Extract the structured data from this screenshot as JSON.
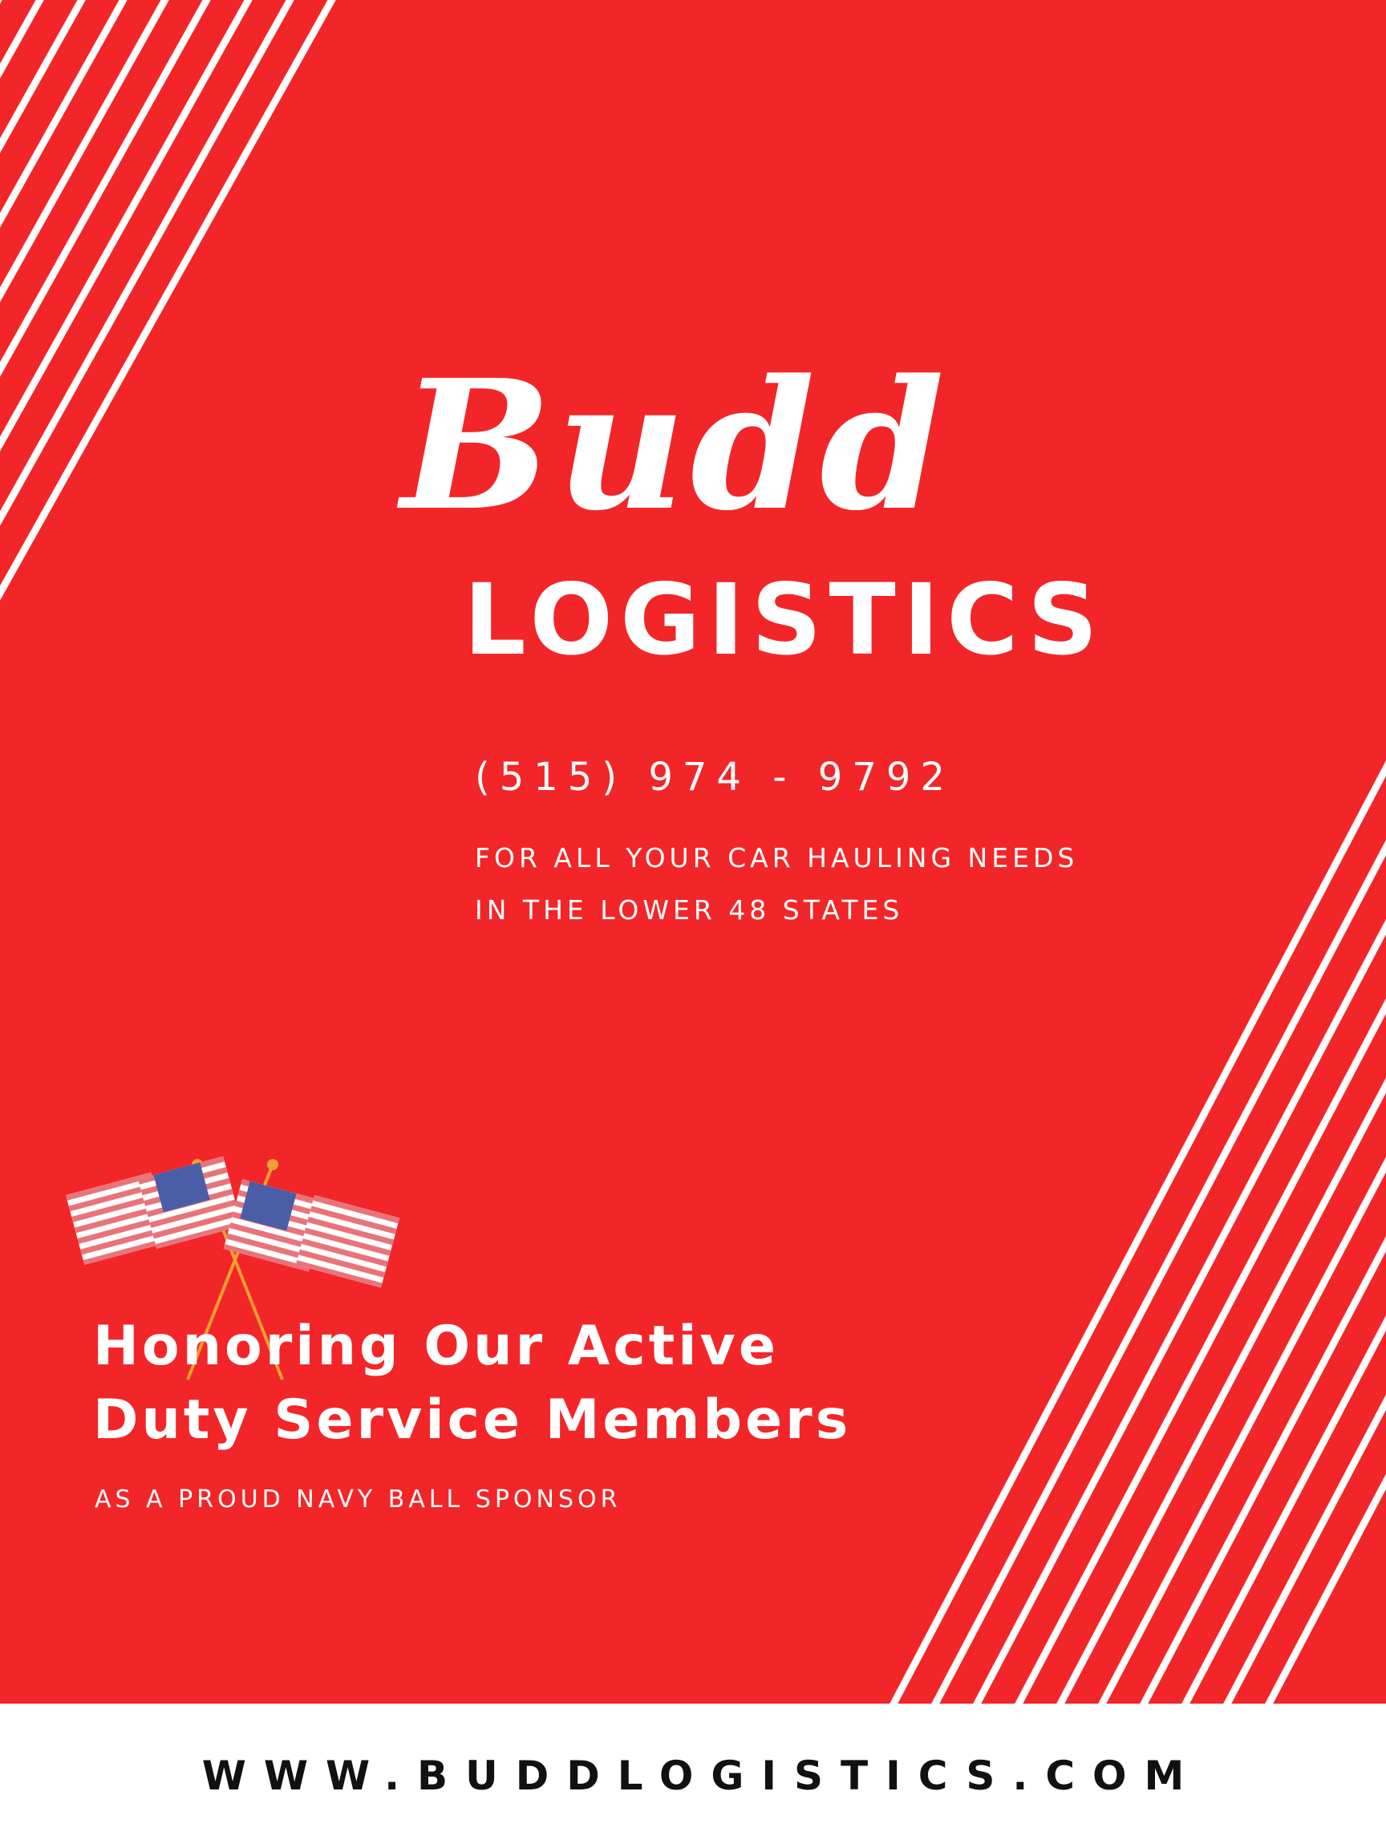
{
  "colors": {
    "background_red": "#f22628",
    "stripe_white": "#ffffff",
    "footer_background": "#ffffff",
    "footer_text": "#111111"
  },
  "brand": {
    "name": "Budd",
    "subtitle": "LOGISTICS"
  },
  "contact": {
    "phone": "(515) 974 - 9792"
  },
  "tagline": {
    "line1": "FOR ALL YOUR CAR HAULING NEEDS",
    "line2": "IN THE LOWER 48 STATES"
  },
  "honor": {
    "line1": "Honoring Our Active",
    "line2": "Duty Service Members",
    "subline": "AS A PROUD NAVY BALL SPONSOR"
  },
  "decoration": {
    "icon": "crossed-american-flags-icon"
  },
  "footer": {
    "website": "WWW.BUDDLOGISTICS.COM"
  }
}
